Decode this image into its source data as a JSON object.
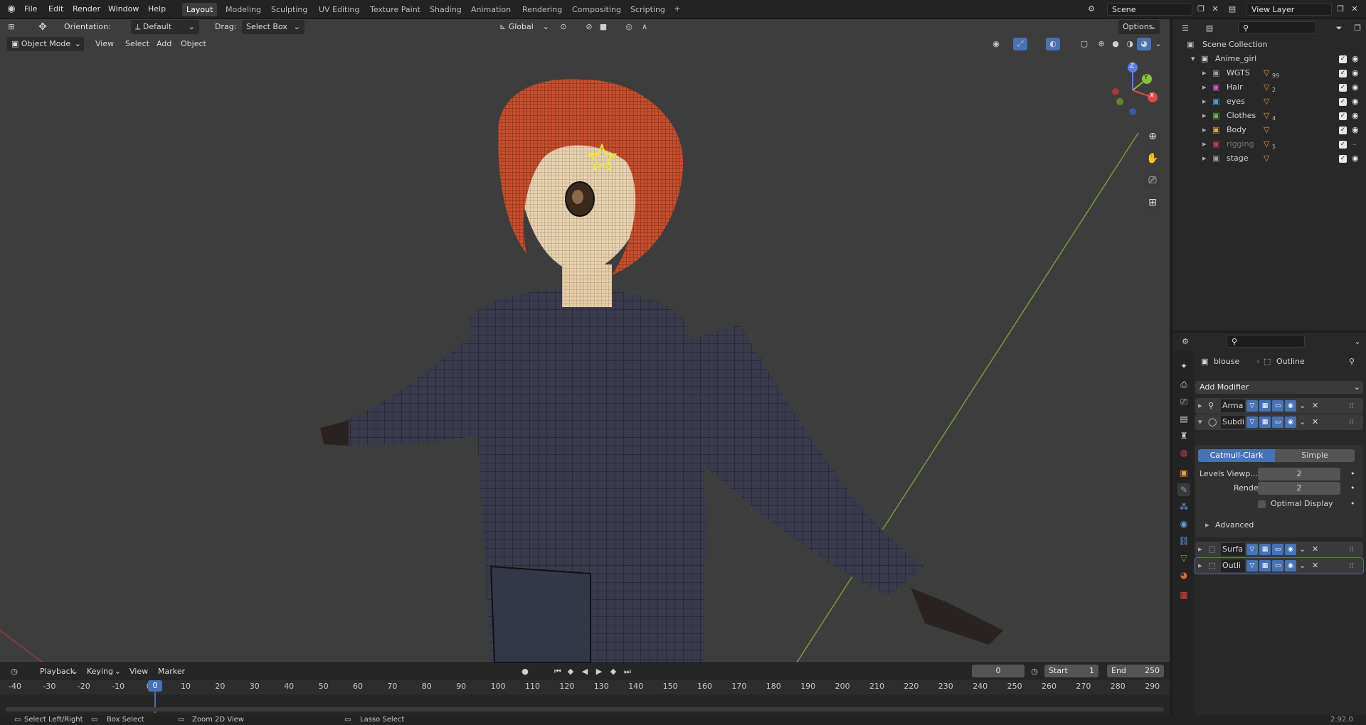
{
  "topbar": {
    "menus": [
      "File",
      "Edit",
      "Render",
      "Window",
      "Help"
    ],
    "workspaces": [
      "Layout",
      "Modeling",
      "Sculpting",
      "UV Editing",
      "Texture Paint",
      "Shading",
      "Animation",
      "Rendering",
      "Compositing",
      "Scripting"
    ],
    "active_workspace": "Layout",
    "scene": "Scene",
    "view_layer": "View Layer"
  },
  "toolbar": {
    "orientation_label": "Orientation:",
    "orientation_value": "Default",
    "drag_label": "Drag:",
    "drag_value": "Select Box",
    "transform_orientation": "Global",
    "options": "Options"
  },
  "viewport_header": {
    "mode": "Object Mode",
    "menus": [
      "View",
      "Select",
      "Add",
      "Object"
    ]
  },
  "gizmo": {
    "z": "Z",
    "y": "Y",
    "x": "X"
  },
  "outliner": {
    "root": "Scene Collection",
    "collection": "Anime_girl",
    "items": [
      {
        "name": "WGTS",
        "color": "#9e9e9e",
        "badge": "99"
      },
      {
        "name": "Hair",
        "color": "#d45dbe",
        "badge": "2"
      },
      {
        "name": "eyes",
        "color": "#4aa3df",
        "badge": ""
      },
      {
        "name": "Clothes",
        "color": "#6fb85a",
        "badge": "4"
      },
      {
        "name": "Body",
        "color": "#e8a24a",
        "badge": ""
      },
      {
        "name": "rigging",
        "color": "#c24747",
        "badge": "5"
      },
      {
        "name": "stage",
        "color": "#9e9e9e",
        "badge": ""
      }
    ]
  },
  "properties": {
    "object": "blouse",
    "modifier_name": "Outline",
    "add_modifier": "Add Modifier",
    "modifiers": [
      "Arma",
      "Subdi",
      "Surfa",
      "Outli"
    ],
    "subdiv_types": [
      "Catmull-Clark",
      "Simple"
    ],
    "levels_viewport_label": "Levels Viewp...",
    "levels_viewport": "2",
    "render_label": "Render",
    "render_value": "2",
    "optimal_display": "Optimal Display",
    "advanced": "Advanced"
  },
  "timeline": {
    "menus": [
      "Playback",
      "Keying",
      "View",
      "Marker"
    ],
    "current_frame": "0",
    "start_label": "Start",
    "start": "1",
    "end_label": "End",
    "end": "250",
    "ruler": [
      "-40",
      "-30",
      "-20",
      "-10",
      "0",
      "10",
      "20",
      "30",
      "40",
      "50",
      "60",
      "70",
      "80",
      "90",
      "100",
      "110",
      "120",
      "130",
      "140",
      "150",
      "160",
      "170",
      "180",
      "190",
      "200",
      "210",
      "220",
      "230",
      "240",
      "250",
      "260",
      "270",
      "280",
      "290"
    ]
  },
  "statusbar": {
    "items": [
      "Select Left/Right",
      "Box Select",
      "Zoom 2D View",
      "Lasso Select"
    ],
    "version": "2.92.0"
  }
}
